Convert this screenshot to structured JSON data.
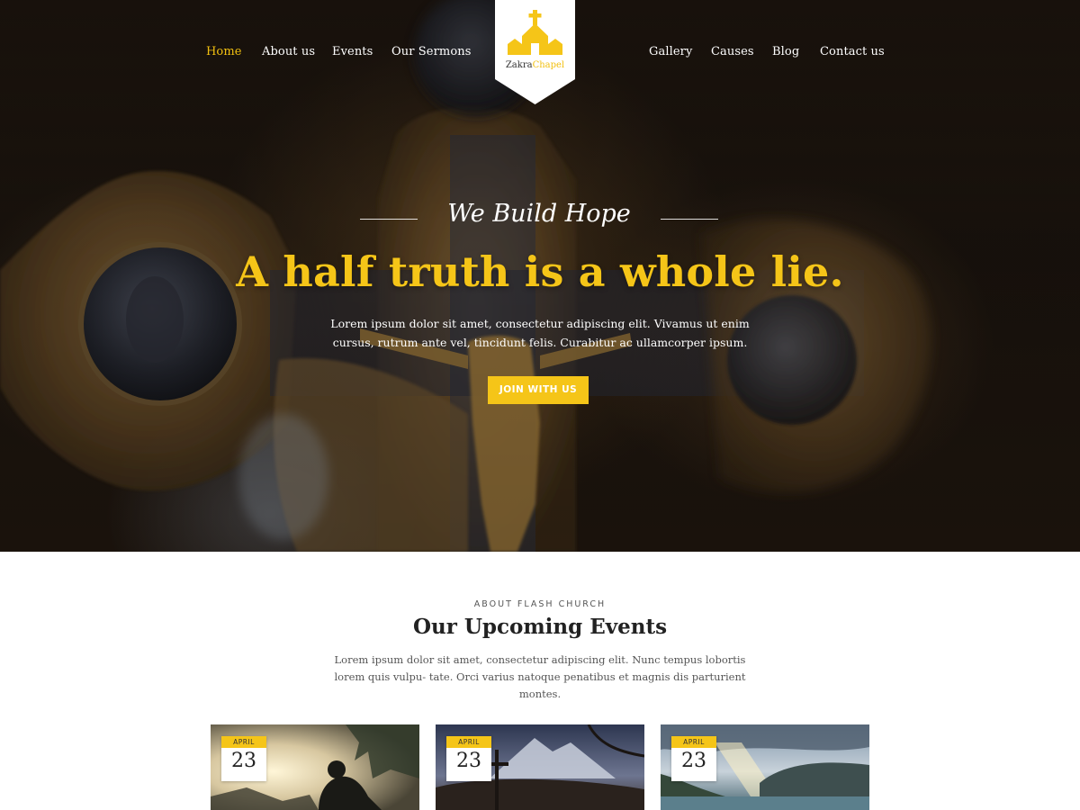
{
  "nav": {
    "left": [
      {
        "label": "Home",
        "active": true
      },
      {
        "label": "About us",
        "active": false
      },
      {
        "label": "Events",
        "active": false
      },
      {
        "label": "Our Sermons",
        "active": false
      }
    ],
    "right": [
      {
        "label": "Gallery",
        "active": false
      },
      {
        "label": "Causes",
        "active": false
      },
      {
        "label": "Blog",
        "active": false
      },
      {
        "label": "Contact us",
        "active": false
      }
    ]
  },
  "logo": {
    "word1": "Zakra",
    "word2": "Chapel",
    "icon": "chapel-icon"
  },
  "hero": {
    "tagline": "We Build Hope",
    "headline": "A half truth is a whole lie.",
    "description": "Lorem ipsum dolor sit amet, consectetur adipiscing elit. Vivamus ut enim cursus, rutrum ante vel, tincidunt felis. Curabitur ac ullamcorper ipsum.",
    "button": "JOIN WITH US"
  },
  "events": {
    "eyebrow": "ABOUT FLASH CHURCH",
    "title": "Our Upcoming Events",
    "description": "Lorem ipsum dolor sit amet, consectetur adipiscing elit. Nunc tempus lobortis lorem quis vulpu- tate. Orci varius natoque penatibus et magnis dis parturient montes.",
    "cards": [
      {
        "month": "APRIL",
        "day": "23"
      },
      {
        "month": "APRIL",
        "day": "23"
      },
      {
        "month": "APRIL",
        "day": "23"
      }
    ]
  },
  "colors": {
    "accent": "#f5c518",
    "nav_text": "#ffffff",
    "heading": "#222222"
  }
}
